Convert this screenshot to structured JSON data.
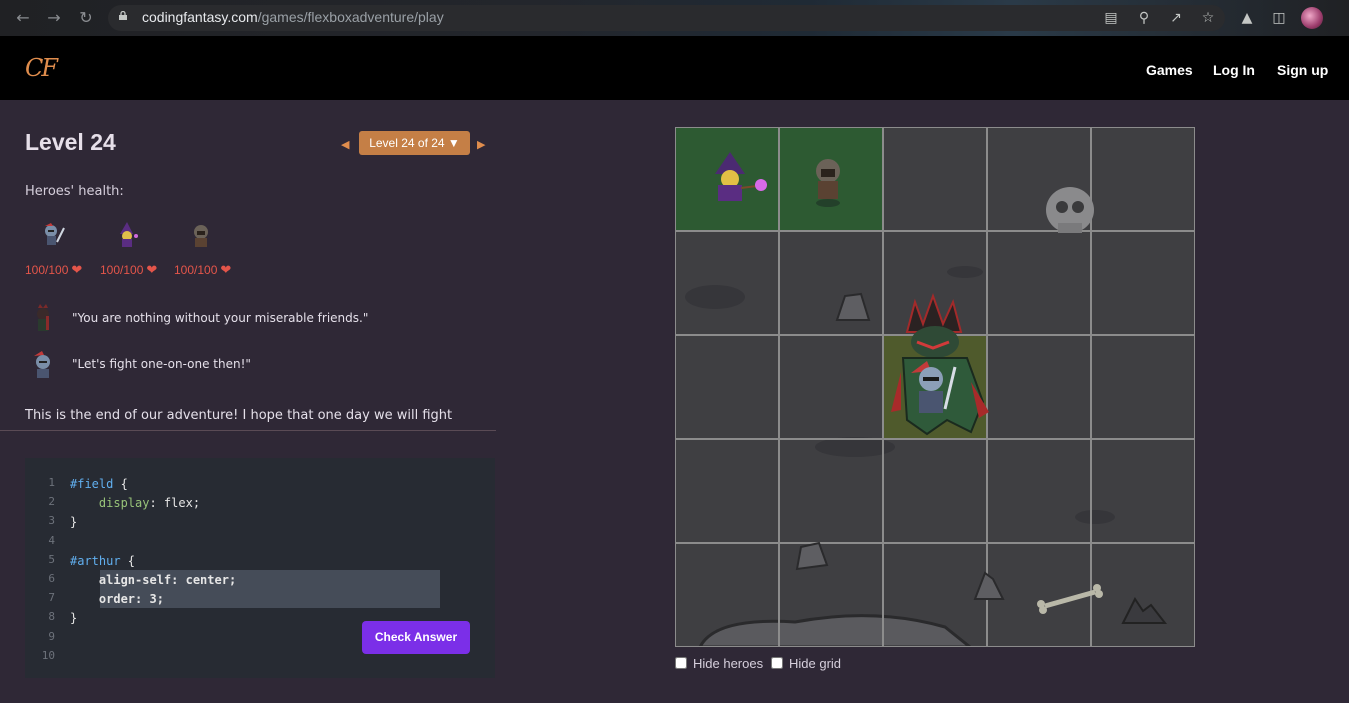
{
  "browser": {
    "url_host": "codingfantasy.com",
    "url_path": "/games/flexboxadventure/play",
    "icons": [
      "back-icon",
      "forward-icon",
      "reload-icon",
      "lock-icon",
      "translate-icon",
      "zoom-icon",
      "share-icon",
      "star-icon",
      "extensions-icon",
      "sidepanel-icon",
      "profile-avatar"
    ]
  },
  "header": {
    "logo": "CF",
    "nav": [
      "Games",
      "Log In",
      "Sign up"
    ]
  },
  "level": {
    "title": "Level 24",
    "selector": "Level 24 of 24 ▼",
    "prev": "◀",
    "next": "▶"
  },
  "health": {
    "label": "Heroes' health:",
    "heroes": [
      {
        "name": "arthur",
        "hp": "100/100"
      },
      {
        "name": "wizard",
        "hp": "100/100"
      },
      {
        "name": "hooded",
        "hp": "100/100"
      }
    ]
  },
  "dialog": [
    {
      "speaker": "villain",
      "text": "\"You are nothing without your miserable friends.\""
    },
    {
      "speaker": "arthur",
      "text": "\"Let's fight one-on-one then!\""
    }
  ],
  "story": "This is the end of our adventure! I hope that one day we will fight",
  "editor": {
    "line_numbers": [
      "1",
      "2",
      "3",
      "4",
      "5",
      "6",
      "7",
      "8",
      "9",
      "10"
    ],
    "lines": [
      {
        "sel": "#field",
        "rest": " {"
      },
      {
        "prop": "    display",
        "rest": ": flex;"
      },
      {
        "rest": "}"
      },
      {
        "rest": ""
      },
      {
        "sel": "#arthur",
        "rest": " {"
      },
      {
        "answer": "    align-self: center;"
      },
      {
        "answer": "    order: 3;"
      },
      {
        "rest": "}"
      }
    ],
    "check_button": "Check Answer"
  },
  "board": {
    "rows": 5,
    "cols": 5,
    "highlight": {
      "green_cells": [
        [
          0,
          0
        ],
        [
          0,
          1
        ]
      ],
      "olive_cells": [
        [
          2,
          2
        ]
      ]
    },
    "colors": {
      "grid": "#8c8c8c",
      "green": "#2d5a32",
      "olive": "#4f5a2c",
      "ground": "#3f3f42"
    }
  },
  "options": {
    "hide_heroes": "Hide heroes",
    "hide_grid": "Hide grid"
  },
  "colors": {
    "accent": "#e08d4d",
    "button": "#7b2fe8",
    "hp": "#e4554a",
    "page_bg": "#2f2836"
  }
}
